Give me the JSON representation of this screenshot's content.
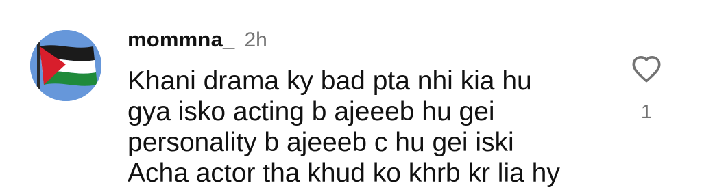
{
  "comment": {
    "avatar_icon": "palestine-flag-icon",
    "username": "mommna_",
    "time": "2h",
    "text_lines": [
      "Khani drama ky bad pta nhi kia hu",
      "gya isko acting b ajeeeb hu gei",
      "personality b ajeeeb c hu gei iski",
      "Acha actor tha khud ko khrb kr lia hy"
    ],
    "like_icon": "heart-outline-icon",
    "like_count": "1"
  },
  "colors": {
    "text": "#111111",
    "muted": "#737373",
    "avatar_background": "#5b8fd6",
    "flag_black": "#1b1b1b",
    "flag_white": "#ffffff",
    "flag_green": "#1f8a3a",
    "flag_red": "#d81e2c"
  }
}
